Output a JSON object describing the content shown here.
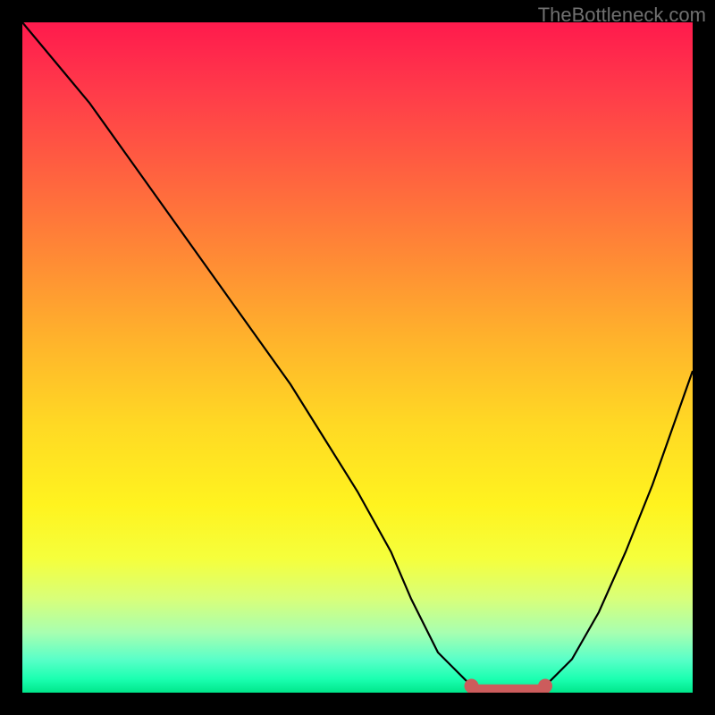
{
  "watermark": "TheBottleneck.com",
  "chart_data": {
    "type": "line",
    "title": "",
    "xlabel": "",
    "ylabel": "",
    "xlim": [
      0,
      100
    ],
    "ylim": [
      0,
      100
    ],
    "series": [
      {
        "name": "bottleneck-curve",
        "x": [
          0,
          5,
          10,
          15,
          20,
          25,
          30,
          35,
          40,
          45,
          50,
          55,
          58,
          62,
          67,
          72,
          75,
          78,
          82,
          86,
          90,
          94,
          100
        ],
        "y": [
          100,
          94,
          88,
          81,
          74,
          67,
          60,
          53,
          46,
          38,
          30,
          21,
          14,
          6,
          1,
          0,
          0,
          1,
          5,
          12,
          21,
          31,
          48
        ]
      }
    ],
    "markers": [
      {
        "name": "flat-zone-start",
        "x": 67,
        "y": 1,
        "color": "#cc5c5c"
      },
      {
        "name": "flat-zone-end",
        "x": 78,
        "y": 1,
        "color": "#cc5c5c"
      }
    ],
    "flat_zone": {
      "x_start": 67,
      "x_end": 78,
      "y": 0.5,
      "color": "#cc5c5c"
    },
    "gradient_colors": {
      "top": "#ff1a4d",
      "mid": "#ffd924",
      "bottom": "#00e68a"
    }
  }
}
